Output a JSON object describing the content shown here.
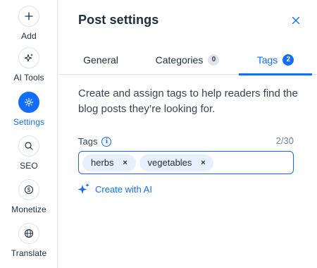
{
  "sidebar": {
    "items": [
      {
        "label": "Add",
        "icon": "plus-icon",
        "active": false
      },
      {
        "label": "AI Tools",
        "icon": "sparkle-icon",
        "active": false
      },
      {
        "label": "Settings",
        "icon": "gear-icon",
        "active": true
      },
      {
        "label": "SEO",
        "icon": "search-icon",
        "active": false
      },
      {
        "label": "Monetize",
        "icon": "dollar-coin-icon",
        "active": false
      },
      {
        "label": "Translate",
        "icon": "globe-icon",
        "active": false
      }
    ]
  },
  "panel": {
    "title": "Post settings",
    "close_icon": "close-icon",
    "tabs": [
      {
        "label": "General",
        "badge": "",
        "active": false
      },
      {
        "label": "Categories",
        "badge": "0",
        "active": false
      },
      {
        "label": "Tags",
        "badge": "2",
        "active": true
      }
    ],
    "description": "Create and assign tags to help readers find the blog posts they’re looking for.",
    "tags_field": {
      "label": "Tags",
      "info_icon": "info-icon",
      "counter": "2/30",
      "value": "",
      "tags": [
        "herbs",
        "vegetables"
      ],
      "remove_glyph": "×"
    },
    "ai_action": {
      "label": "Create with AI",
      "icon": "ai-sparkle-icon"
    }
  },
  "colors": {
    "accent": "#116dff",
    "chip_bg": "#e7f0ff",
    "text": "#20303c",
    "border": "#dfe5eb"
  }
}
